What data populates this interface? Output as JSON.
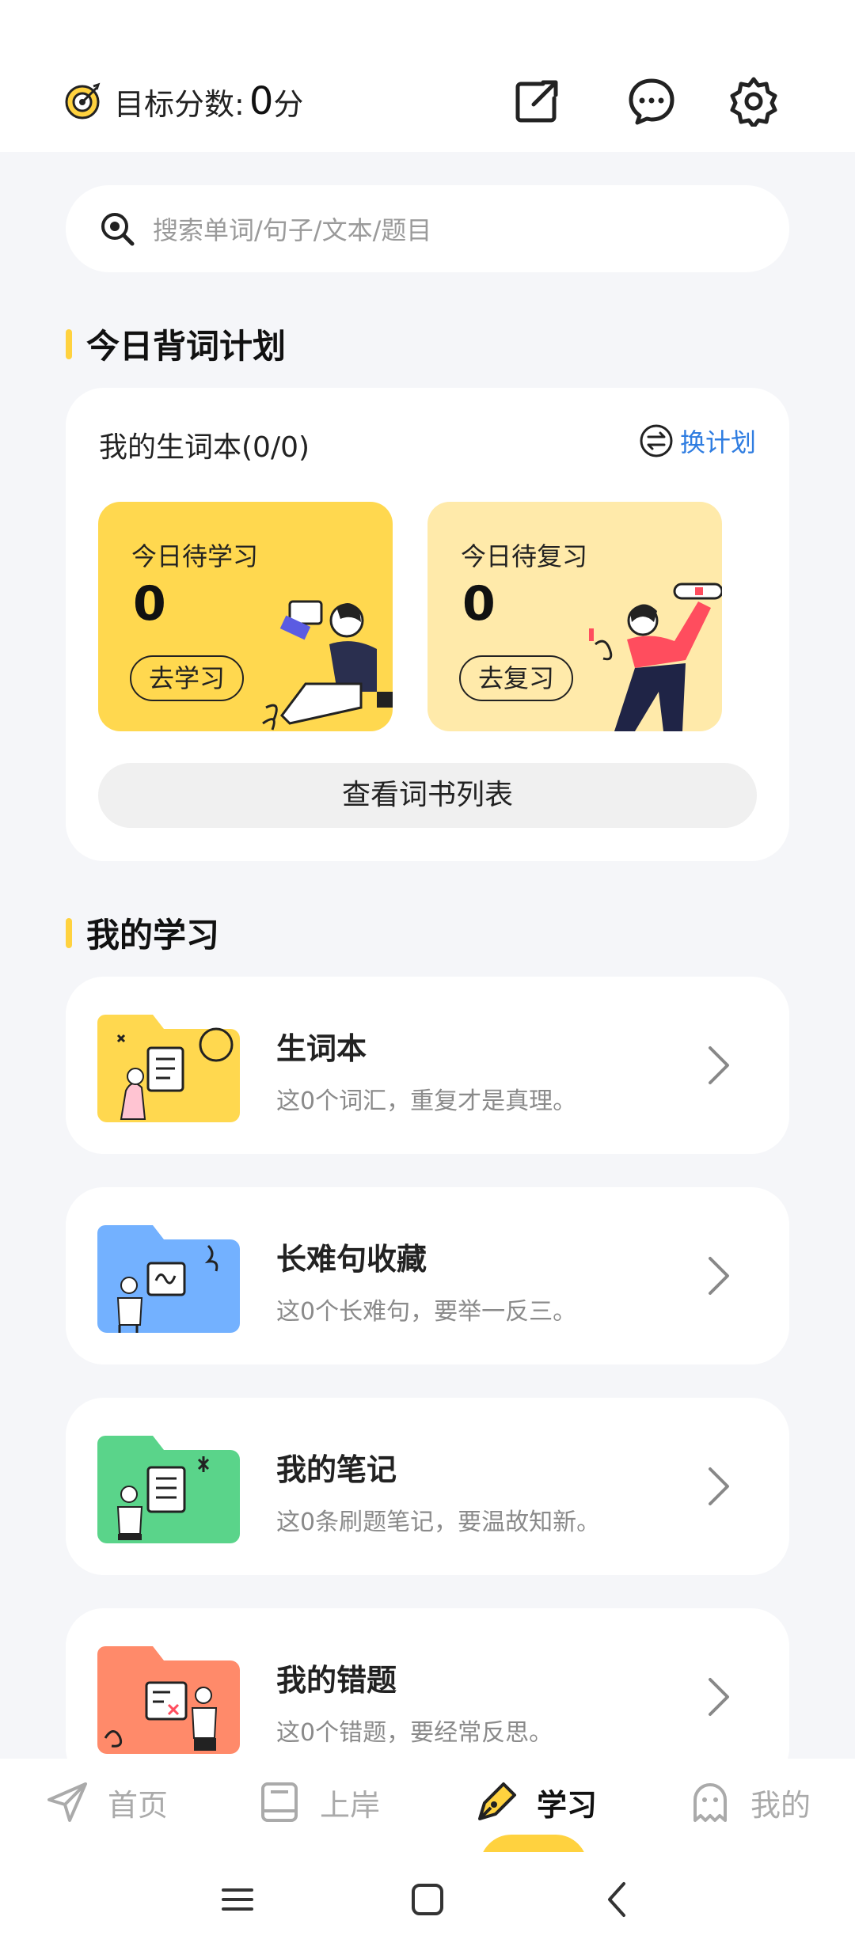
{
  "header": {
    "target_label": "目标分数:",
    "target_value": "0",
    "target_unit": "分",
    "icons": [
      "target-icon",
      "share-icon",
      "message-icon",
      "settings-icon"
    ]
  },
  "search": {
    "placeholder": "搜索单词/句子/文本/题目"
  },
  "plan": {
    "section_title": "今日背词计划",
    "book_title": "我的生词本(0/0)",
    "switch_label": "换计划",
    "learn": {
      "label": "今日待学习",
      "count": "0",
      "button": "去学习"
    },
    "review": {
      "label": "今日待复习",
      "count": "0",
      "button": "去复习"
    },
    "list_button": "查看词书列表"
  },
  "study": {
    "section_title": "我的学习",
    "items": [
      {
        "title": "生词本",
        "subtitle": "这0个词汇，重复才是真理。",
        "color": "#ffd84f"
      },
      {
        "title": "长难句收藏",
        "subtitle": "这0个长难句，要举一反三。",
        "color": "#73b1ff"
      },
      {
        "title": "我的笔记",
        "subtitle": "这0条刷题笔记，要温故知新。",
        "color": "#5ad48a"
      },
      {
        "title": "我的错题",
        "subtitle": "这0个错题，要经常反思。",
        "color": "#ff8a6a"
      }
    ]
  },
  "tabbar": {
    "tabs": [
      {
        "label": "首页",
        "icon": "send-icon"
      },
      {
        "label": "上岸",
        "icon": "book-icon"
      },
      {
        "label": "学习",
        "icon": "pen-icon",
        "active": true
      },
      {
        "label": "我的",
        "icon": "ghost-icon"
      }
    ]
  },
  "colors": {
    "accent": "#ffd23f",
    "link": "#2f7de1",
    "background": "#f5f6f9"
  }
}
